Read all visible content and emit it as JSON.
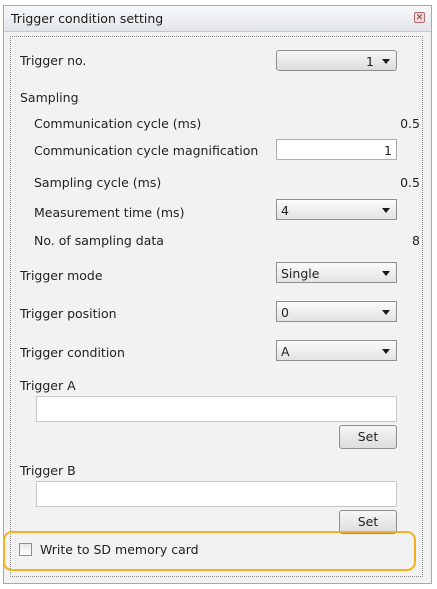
{
  "window": {
    "title": "Trigger condition setting",
    "close_icon": "close-icon"
  },
  "trigger_no": {
    "label": "Trigger no.",
    "value": "1"
  },
  "sampling": {
    "heading": "Sampling",
    "communication_cycle": {
      "label": "Communication cycle (ms)",
      "value": "0.5"
    },
    "magnification": {
      "label": "Communication cycle magnification",
      "value": "1"
    },
    "sampling_cycle": {
      "label": "Sampling cycle (ms)",
      "value": "0.5"
    },
    "measurement_time": {
      "label": "Measurement time (ms)",
      "value": "4"
    },
    "sampling_data": {
      "label": "No. of sampling data",
      "value": "8"
    }
  },
  "trigger_mode": {
    "label": "Trigger mode",
    "value": "Single"
  },
  "trigger_position": {
    "label": "Trigger position",
    "value": "0"
  },
  "trigger_condition": {
    "label": "Trigger condition",
    "value": "A"
  },
  "trigger_a": {
    "label": "Trigger A",
    "value": "",
    "set_label": "Set"
  },
  "trigger_b": {
    "label": "Trigger B",
    "value": "",
    "set_label": "Set"
  },
  "sd_card": {
    "label": "Write to SD memory card",
    "checked": false
  },
  "colors": {
    "highlight": "#f3b21c",
    "panel_bg": "#f2f2f2"
  }
}
